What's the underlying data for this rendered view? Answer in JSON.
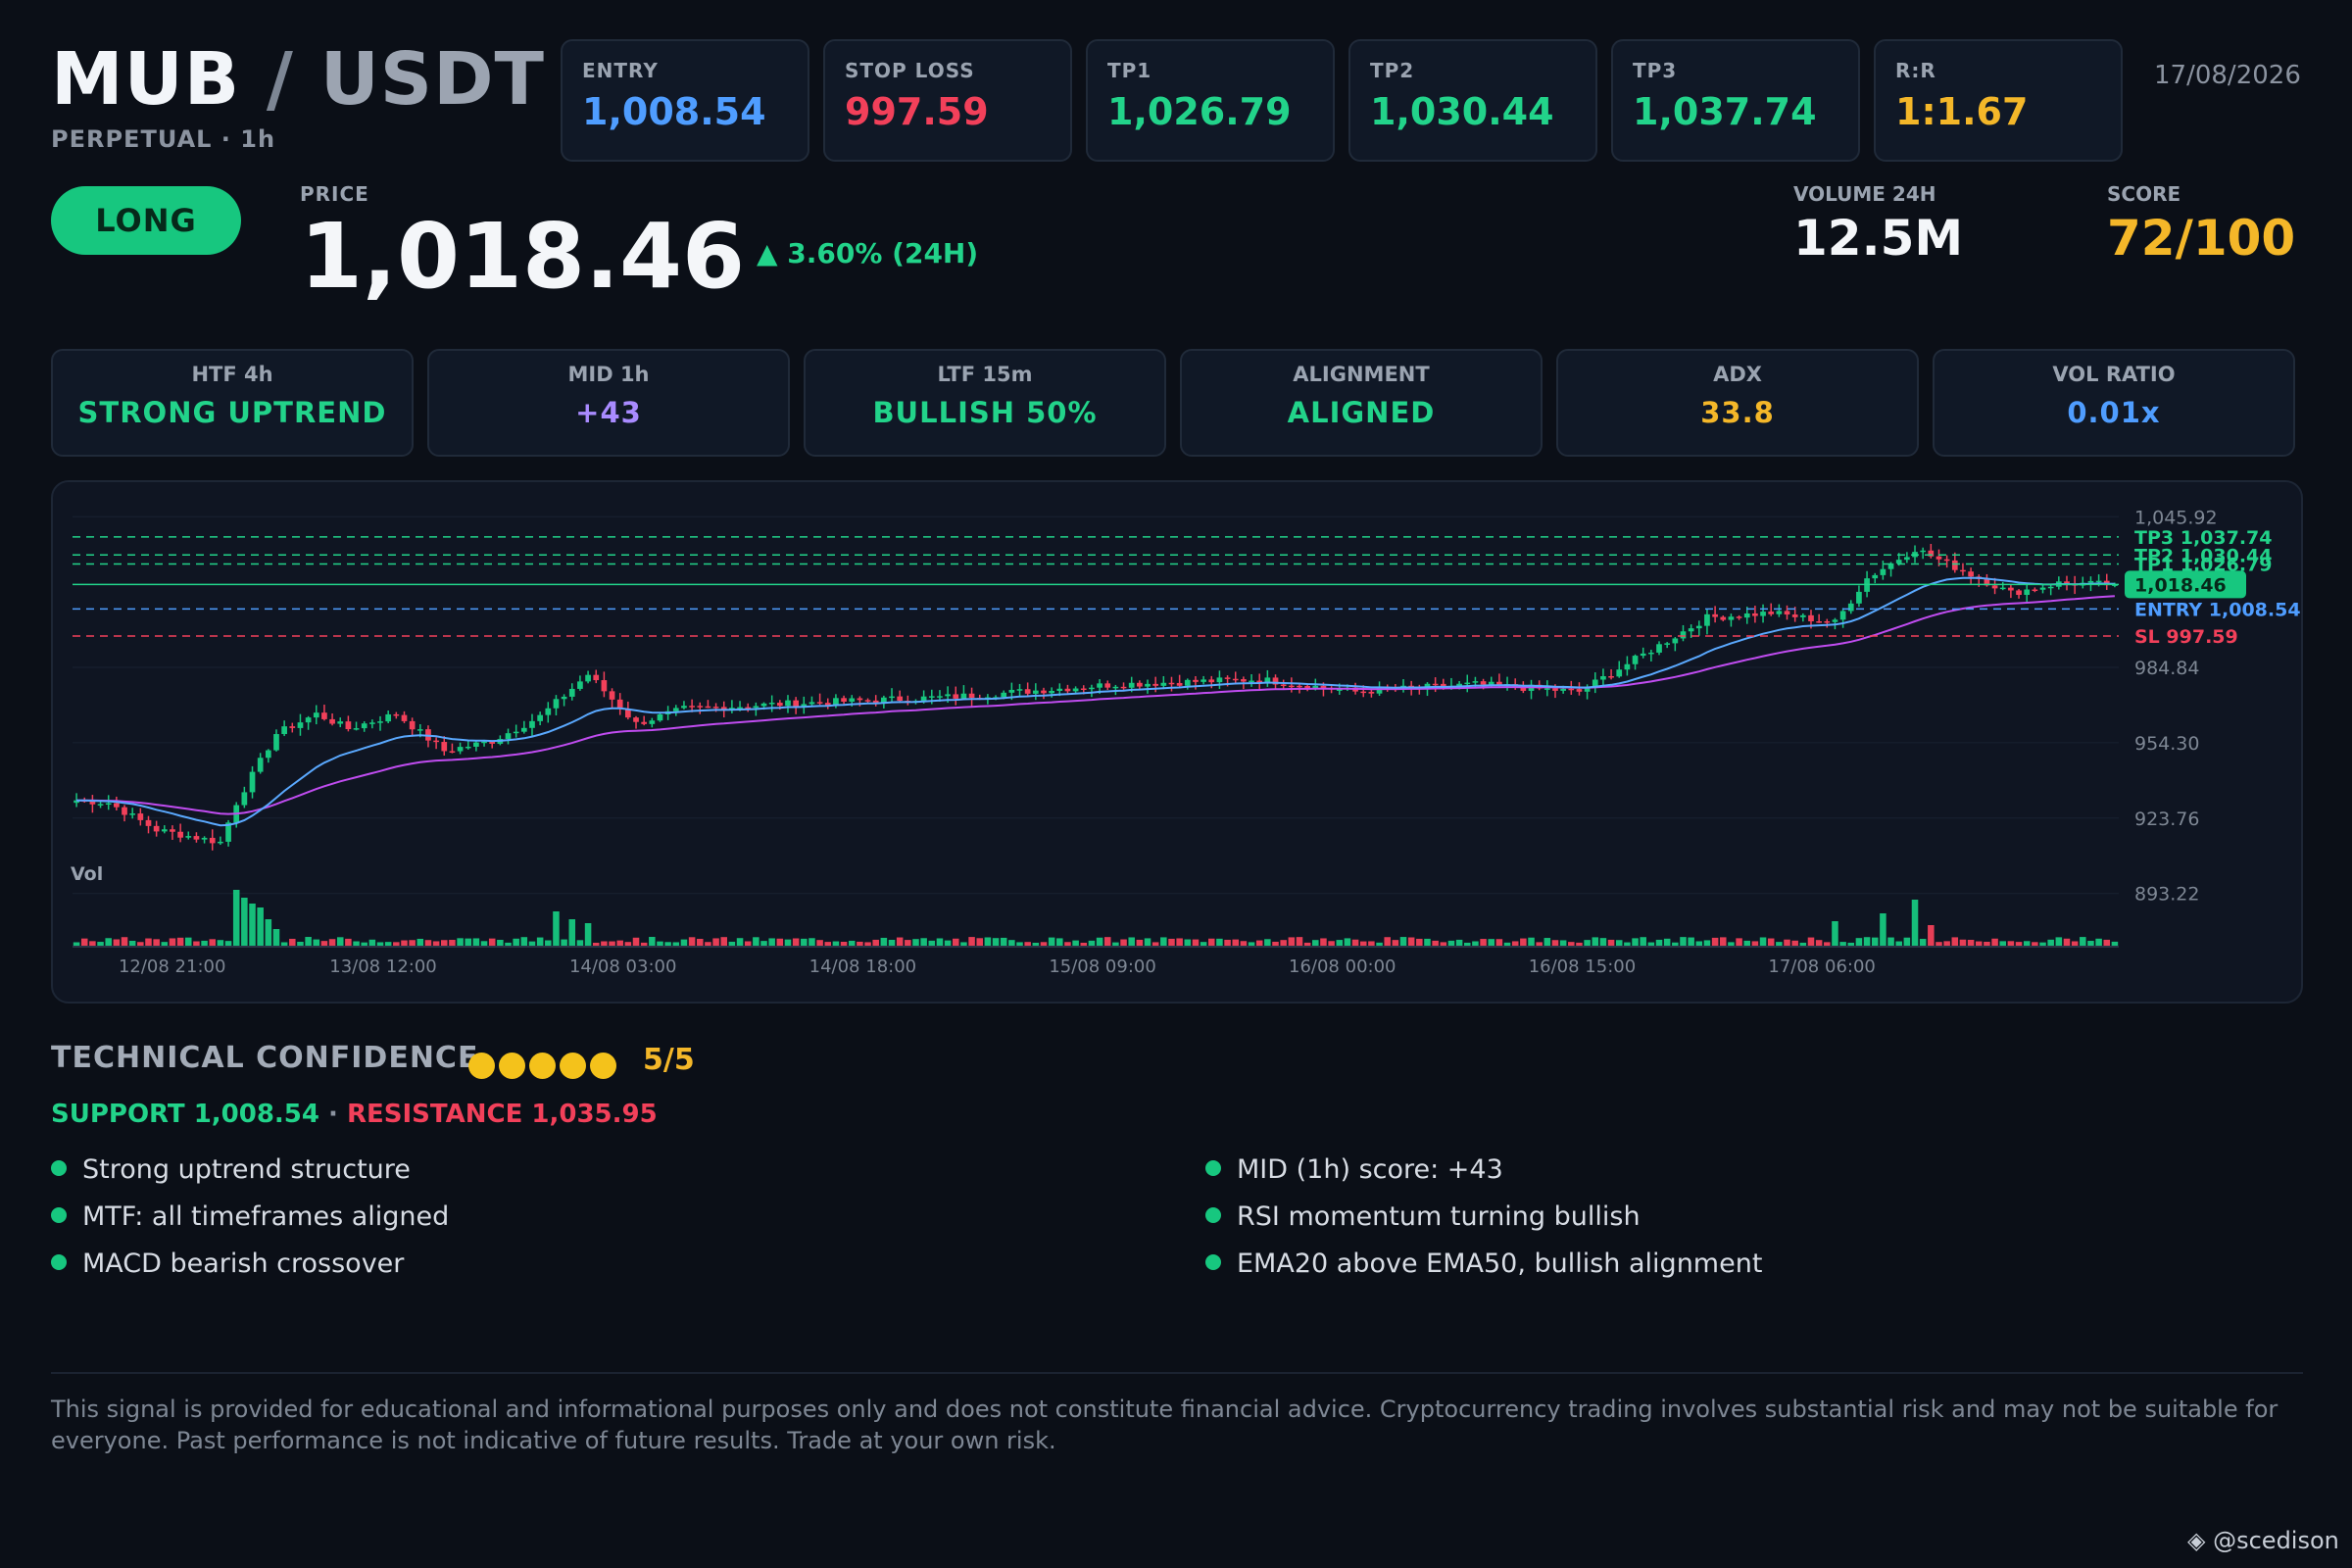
{
  "header": {
    "base": "MUB",
    "separator": "/",
    "quote": "USDT",
    "subtitle": "PERPETUAL · 1h",
    "date": "17/08/2026"
  },
  "levels": [
    {
      "label": "ENTRY",
      "value": "1,008.54",
      "color": "#4f9dff"
    },
    {
      "label": "STOP LOSS",
      "value": "997.59",
      "color": "#f2405a"
    },
    {
      "label": "TP1",
      "value": "1,026.79",
      "color": "#22d38a"
    },
    {
      "label": "TP2",
      "value": "1,030.44",
      "color": "#22d38a"
    },
    {
      "label": "TP3",
      "value": "1,037.74",
      "color": "#22d38a"
    },
    {
      "label": "R:R",
      "value": "1:1.67",
      "color": "#f4b729"
    }
  ],
  "signal": {
    "direction": "LONG"
  },
  "price": {
    "label": "PRICE",
    "value": "1,018.46",
    "change": "▲ 3.60% (24H)"
  },
  "volume": {
    "label": "VOLUME 24H",
    "value": "12.5M"
  },
  "score": {
    "label": "SCORE",
    "value": "72/100"
  },
  "metrics": [
    {
      "label": "HTF 4h",
      "value": "STRONG UPTREND",
      "color": "#22d38a"
    },
    {
      "label": "MID 1h",
      "value": "+43",
      "color": "#a98bff"
    },
    {
      "label": "LTF 15m",
      "value": "BULLISH 50%",
      "color": "#22d38a"
    },
    {
      "label": "ALIGNMENT",
      "value": "ALIGNED",
      "color": "#22d38a"
    },
    {
      "label": "ADX",
      "value": "33.8",
      "color": "#f4b729"
    },
    {
      "label": "VOL RATIO",
      "value": "0.01x",
      "color": "#4f9dff"
    }
  ],
  "chart": {
    "y_ticks": [
      "1,045.92",
      "984.84",
      "954.30",
      "923.76",
      "893.22"
    ],
    "x_ticks": [
      "12/08 21:00",
      "13/08 12:00",
      "14/08 03:00",
      "14/08 18:00",
      "15/08 09:00",
      "16/08 00:00",
      "16/08 15:00",
      "17/08 06:00"
    ],
    "vol_label": "Vol",
    "tp3_label": "TP3 1,037.74",
    "tp2_label": "TP2 1,030.44",
    "tp1_label": "TP1 1,026.79",
    "price_label": "1,018.46",
    "entry_label": "ENTRY 1,008.54",
    "sl_label": "SL 997.59",
    "colors": {
      "up": "#17c77f",
      "down": "#f2405a",
      "ema20": "#5aa9ff",
      "ema50": "#c04cf0"
    }
  },
  "chart_data": {
    "type": "candlestick",
    "title": "",
    "xlabel": "",
    "ylabel": "",
    "ylim": [
      878,
      1052
    ],
    "y_ticks": [
      1045.92,
      984.84,
      954.3,
      923.76,
      893.22
    ],
    "x_ticks": [
      "12/08 21:00",
      "13/08 12:00",
      "14/08 03:00",
      "14/08 18:00",
      "15/08 09:00",
      "16/08 00:00",
      "16/08 15:00",
      "17/08 06:00"
    ],
    "levels": {
      "tp3": 1037.74,
      "tp2": 1030.44,
      "tp1": 1026.79,
      "price": 1018.46,
      "entry": 1008.54,
      "sl": 997.59
    },
    "waypoints": [
      {
        "i": 0,
        "price": 931
      },
      {
        "i": 4,
        "price": 930
      },
      {
        "i": 10,
        "price": 919
      },
      {
        "i": 18,
        "price": 914
      },
      {
        "i": 20,
        "price": 930
      },
      {
        "i": 25,
        "price": 958
      },
      {
        "i": 30,
        "price": 966
      },
      {
        "i": 34,
        "price": 960
      },
      {
        "i": 40,
        "price": 966
      },
      {
        "i": 46,
        "price": 951
      },
      {
        "i": 52,
        "price": 955
      },
      {
        "i": 58,
        "price": 965
      },
      {
        "i": 64,
        "price": 982
      },
      {
        "i": 70,
        "price": 962
      },
      {
        "i": 76,
        "price": 968
      },
      {
        "i": 88,
        "price": 970
      },
      {
        "i": 110,
        "price": 973
      },
      {
        "i": 130,
        "price": 978
      },
      {
        "i": 148,
        "price": 980
      },
      {
        "i": 160,
        "price": 975
      },
      {
        "i": 175,
        "price": 978
      },
      {
        "i": 188,
        "price": 975
      },
      {
        "i": 196,
        "price": 990
      },
      {
        "i": 204,
        "price": 1005
      },
      {
        "i": 212,
        "price": 1007
      },
      {
        "i": 220,
        "price": 1003
      },
      {
        "i": 224,
        "price": 1021
      },
      {
        "i": 230,
        "price": 1033
      },
      {
        "i": 236,
        "price": 1024
      },
      {
        "i": 242,
        "price": 1015
      },
      {
        "i": 248,
        "price": 1019
      },
      {
        "i": 255,
        "price": 1018.46
      }
    ],
    "candle_count": 256
  },
  "confidence": {
    "title": "TECHNICAL CONFIDENCE",
    "score": "5/5",
    "dots": 5,
    "support": "SUPPORT 1,008.54",
    "dot_sep": " · ",
    "resistance": "RESISTANCE 1,035.95"
  },
  "bullets_left": [
    "Strong uptrend structure",
    "MTF: all timeframes aligned",
    "MACD bearish crossover"
  ],
  "bullets_right": [
    "MID (1h) score: +43",
    "RSI momentum turning bullish",
    "EMA20 above EMA50, bullish alignment"
  ],
  "disclaimer": "This signal is provided for educational and informational purposes only and does not constitute financial advice. Cryptocurrency trading involves substantial risk and may not be suitable for everyone. Past performance is not indicative of future results. Trade at your own risk.",
  "credit": "@scedison"
}
